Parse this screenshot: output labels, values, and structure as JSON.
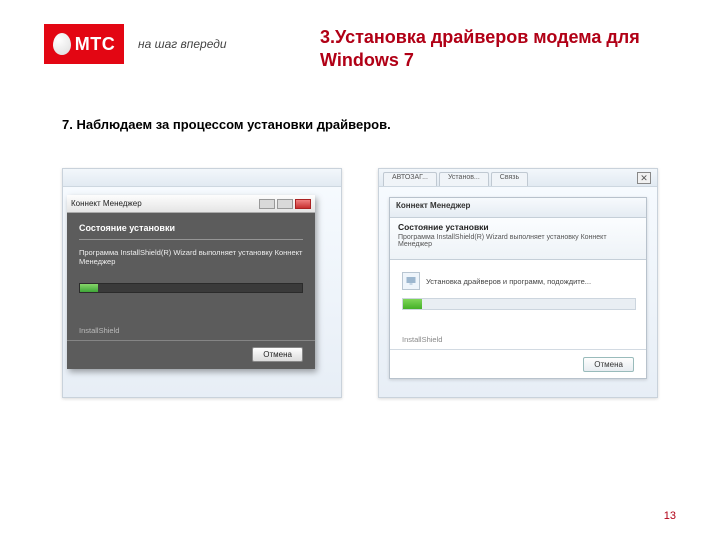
{
  "logo": {
    "text": "МТС",
    "tagline": "на шаг впереди"
  },
  "title": "3.Установка драйверов модема для Windows 7",
  "subtitle": "7. Наблюдаем за процессом установки драйверов.",
  "shot1": {
    "window_title": "Коннект Менеджер",
    "heading": "Состояние установки",
    "body": "Программа InstallShield(R) Wizard выполняет установку Коннект Менеджер",
    "footer": "InstallShield",
    "cancel_label": "Отмена"
  },
  "shot2": {
    "tabs": [
      "АВТОЗАГ...",
      "Установ...",
      "Связь"
    ],
    "close_glyph": "✕",
    "window_title": "Коннект Менеджер",
    "heading": "Состояние установки",
    "body": "Программа InstallShield(R) Wizard выполняет установку Коннект Менеджер",
    "status": "Установка драйверов и программ, подождите...",
    "footer": "InstallShield",
    "cancel_label": "Отмена"
  },
  "page_number": "13"
}
